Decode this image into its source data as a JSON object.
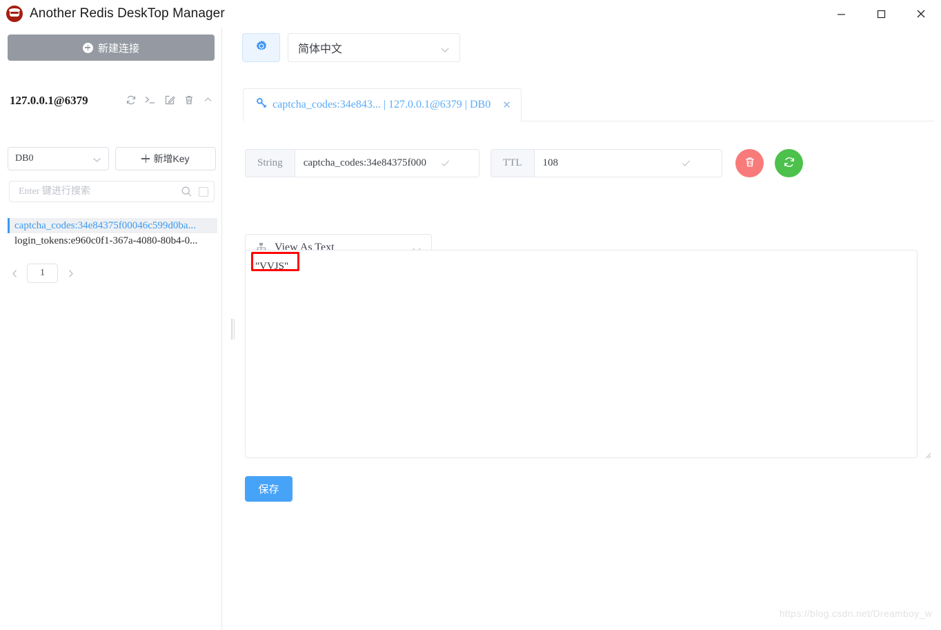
{
  "window": {
    "title": "Another Redis DeskTop Manager",
    "logo_icon": "redis-logo-icon",
    "minimize_label": "─",
    "maximize_label": "□",
    "close_label": "✕"
  },
  "sidebar": {
    "new_connection_label": "新建连接",
    "connection": {
      "name": "127.0.0.1@6379",
      "icons": [
        {
          "name": "refresh-icon",
          "glyph": "refresh"
        },
        {
          "name": "console-icon",
          "glyph": ">_"
        },
        {
          "name": "edit-icon",
          "glyph": "edit"
        },
        {
          "name": "delete-icon",
          "glyph": "trash"
        },
        {
          "name": "collapse-icon",
          "glyph": "chevron-up"
        }
      ]
    },
    "db_select_value": "DB0",
    "add_key_label": "新增Key",
    "search_placeholder": "Enter 键进行搜索",
    "search_value": "",
    "keys": [
      {
        "label": "captcha_codes:34e84375f00046c599d0ba...",
        "selected": true
      },
      {
        "label": "login_tokens:e960c0f1-367a-4080-80b4-0...",
        "selected": false
      }
    ],
    "pagination": {
      "prev_label": "‹",
      "page": "1",
      "next_label": "›"
    }
  },
  "main": {
    "settings_icon": "gear-icon",
    "language_select_value": "简体中文",
    "tab": {
      "icon": "key-icon",
      "label": "captcha_codes:34e843... | 127.0.0.1@6379 | DB0",
      "close_label": "✕"
    },
    "key_info": {
      "type_label": "String",
      "key_value": "captcha_codes:34e84375f000",
      "ttl_label": "TTL",
      "ttl_value": "108",
      "delete_button_icon": "trash-icon",
      "refresh_button_icon": "refresh-icon"
    },
    "view_as": {
      "icon": "sitemap-icon",
      "value": "View As Text"
    },
    "value_content": "\"VVJS\"",
    "save_label": "保存"
  },
  "watermark": "https://blog.csdn.net/Dreamboy_w",
  "colors": {
    "accent_blue": "#47a3f7",
    "tab_blue": "#5babf7",
    "delete_red": "#f97a7a",
    "refresh_green": "#4cc14c",
    "new_conn_gray": "#959aa2",
    "annotation_red": "#ff0000"
  }
}
